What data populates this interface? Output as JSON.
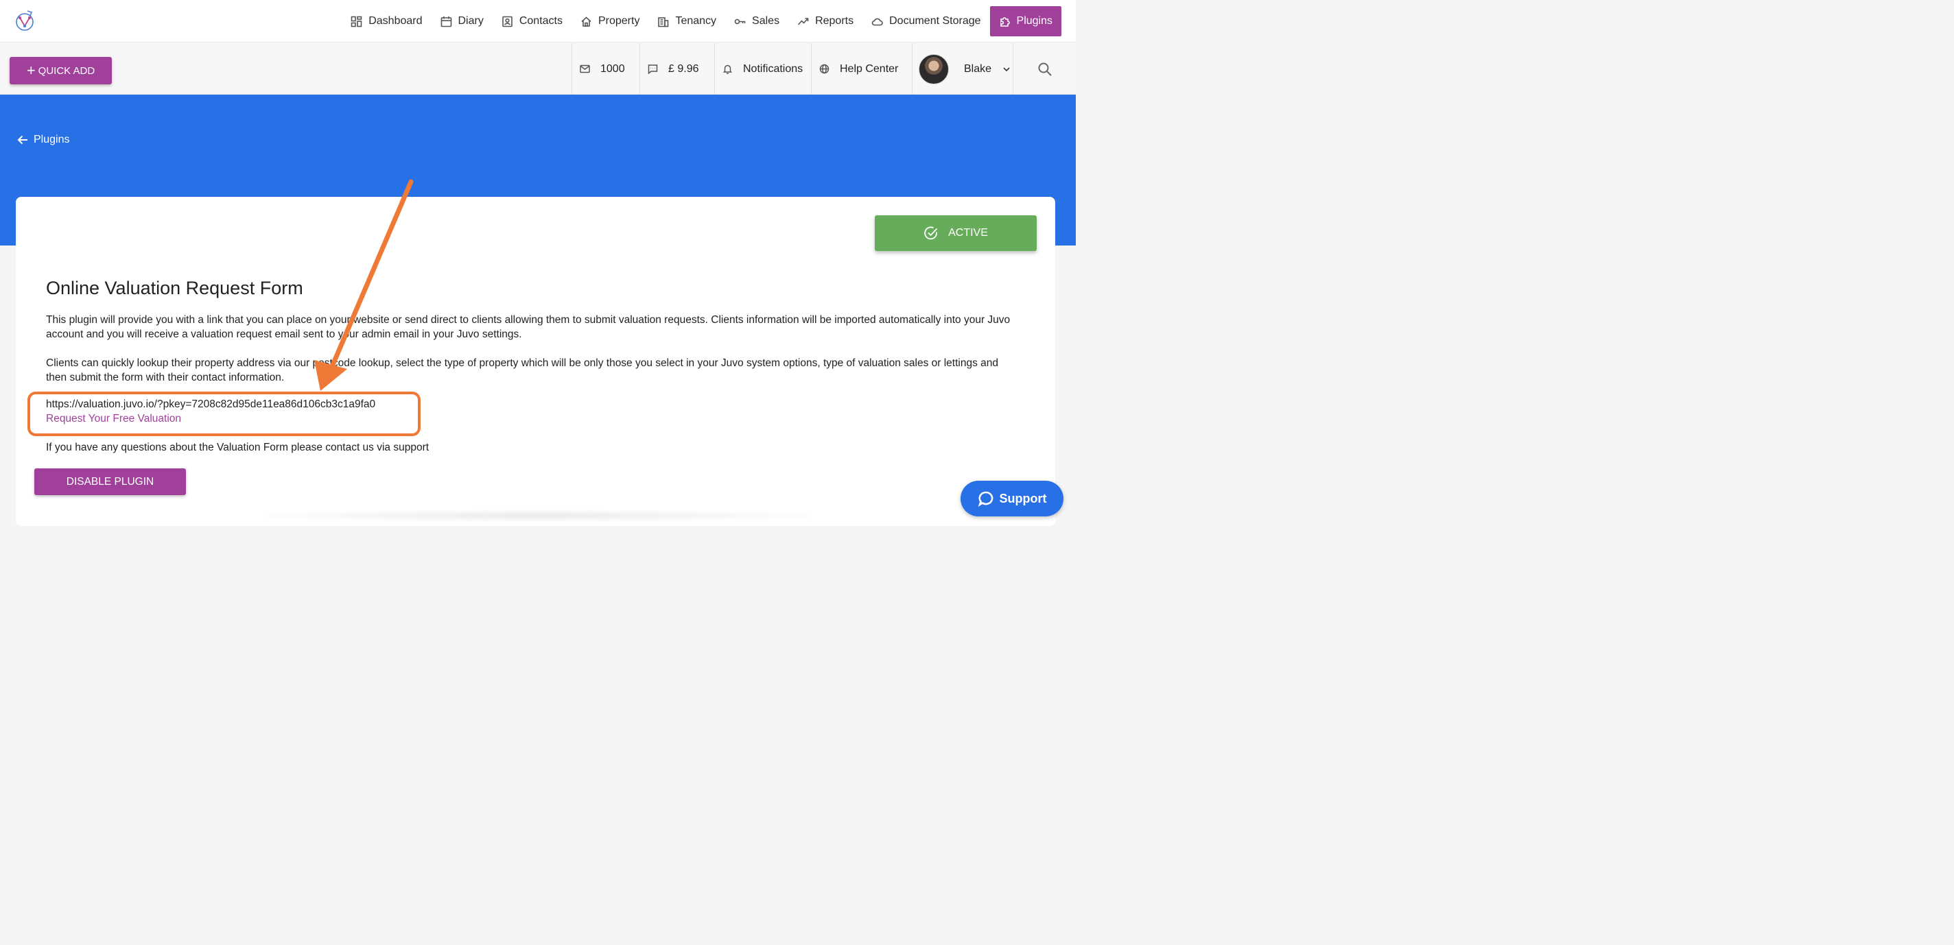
{
  "nav": {
    "items": [
      {
        "label": "Dashboard",
        "icon": "dashboard-icon"
      },
      {
        "label": "Diary",
        "icon": "calendar-icon"
      },
      {
        "label": "Contacts",
        "icon": "contact-card-icon"
      },
      {
        "label": "Property",
        "icon": "home-icon"
      },
      {
        "label": "Tenancy",
        "icon": "building-icon"
      },
      {
        "label": "Sales",
        "icon": "key-icon"
      },
      {
        "label": "Reports",
        "icon": "trend-icon"
      },
      {
        "label": "Document Storage",
        "icon": "cloud-icon"
      },
      {
        "label": "Plugins",
        "icon": "puzzle-icon",
        "active": true
      }
    ]
  },
  "toolbar": {
    "quick_add_label": "QUICK ADD",
    "sms_count": "1000",
    "credit": "£ 9.96",
    "notifications_label": "Notifications",
    "help_label": "Help Center",
    "user_name": "Blake"
  },
  "banner": {
    "back_label": "Plugins"
  },
  "plugin": {
    "status_label": "ACTIVE",
    "title": "Online Valuation Request Form",
    "paragraph1": "This plugin will provide you with a link that you can place on your website or send direct to clients allowing them to submit valuation requests. Clients information will be imported automatically into your Juvo account and you will receive a valuation request email sent to your admin email in your Juvo settings.",
    "paragraph2": "Clients can quickly lookup their property address via our postcode lookup, select the type of property which will be only those you select in your Juvo system options, type of valuation sales or lettings and then submit the form with their contact information.",
    "url": "https://valuation.juvo.io/?pkey=7208c82d95de11ea86d106cb3c1a9fa0",
    "link_label": "Request Your Free Valuation",
    "help_text": "If you have any questions about the Valuation Form please contact us via support",
    "disable_label": "DISABLE PLUGIN"
  },
  "support": {
    "label": "Support"
  },
  "colors": {
    "brand_purple": "#a0409a",
    "banner_blue": "#2870e6",
    "active_green": "#67ac5b",
    "annotation_orange": "#ef7a37"
  }
}
